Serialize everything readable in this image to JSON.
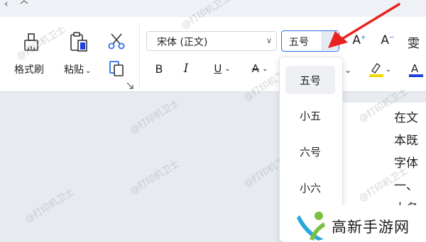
{
  "ribbon": {
    "format_painter_label": "格式刷",
    "paste_label": "粘贴",
    "font_name": "宋体 (正文)",
    "font_size": "五号",
    "partial_top_right": "雯"
  },
  "font_size_dropdown": {
    "items": [
      "五号",
      "小五",
      "六号",
      "小六"
    ],
    "selected": "五号"
  },
  "document": {
    "lines": [
      "在文",
      "本既",
      "字体",
      "一、",
      "大名"
    ]
  },
  "watermark_text": "@打印机卫士",
  "site_logo": {
    "text": "高新手游网"
  },
  "colors": {
    "highlight_bar": "#f2d600",
    "font_color_bar": "#1f3fe0",
    "annotation_arrow": "#e8231f",
    "focus_border": "#2f6fe8"
  },
  "icons": [
    "format-painter-icon",
    "paste-icon",
    "cut-icon",
    "copy-icon",
    "bold-icon",
    "italic-icon",
    "underline-icon",
    "strikethrough-icon",
    "increase-font-icon",
    "decrease-font-icon",
    "highlight-icon",
    "font-color-icon",
    "dialog-launcher-icon"
  ]
}
